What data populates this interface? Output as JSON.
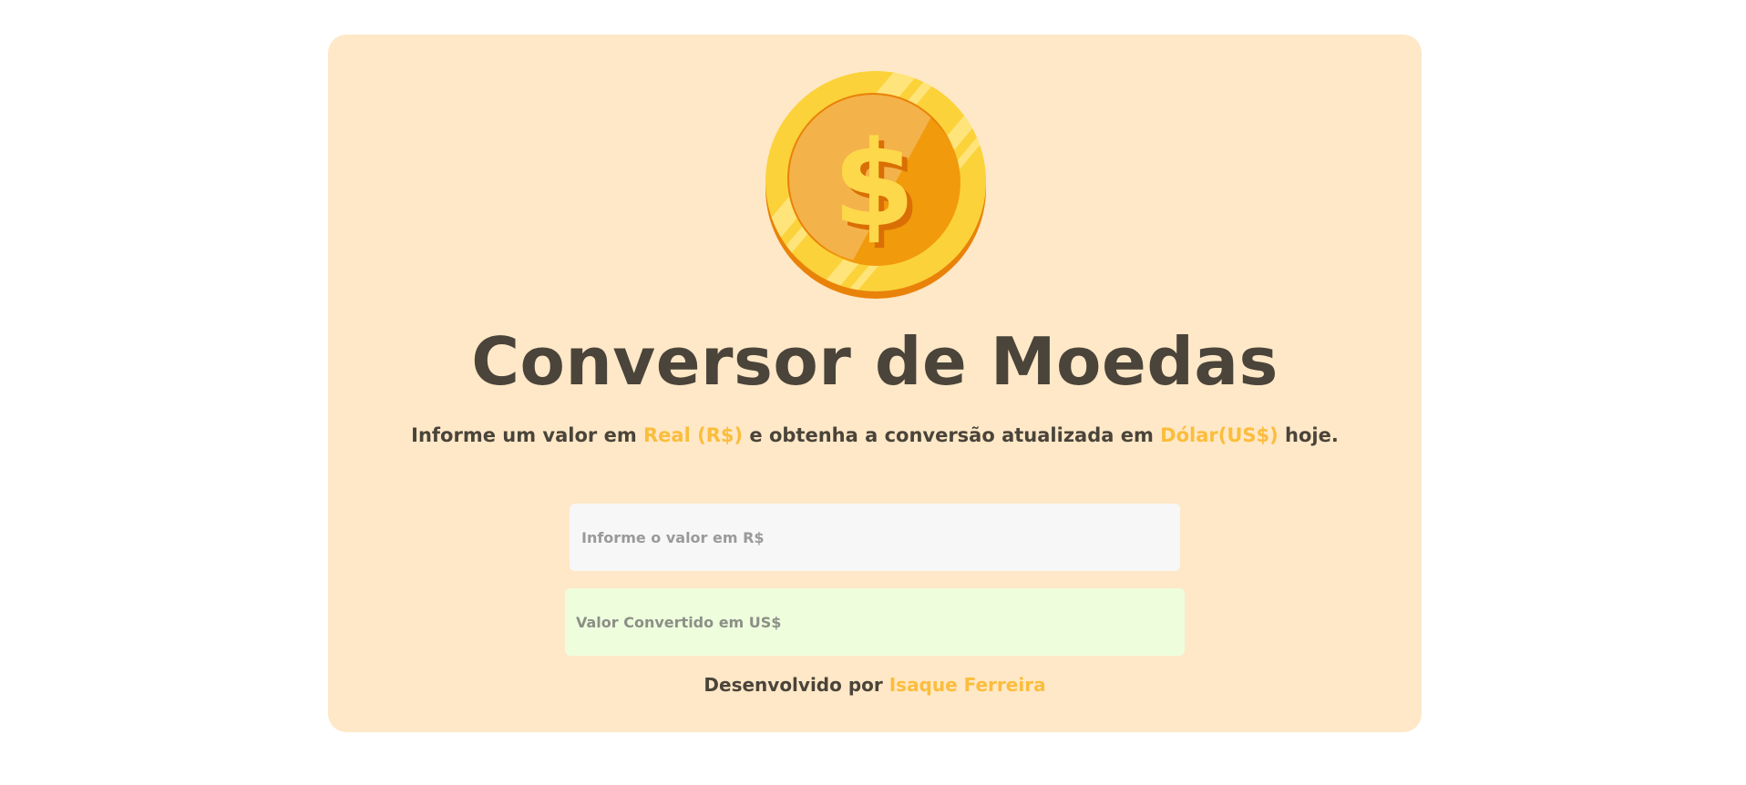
{
  "header": {
    "logo_icon": "dollar-coin-icon",
    "title": "Conversor de Moedas"
  },
  "subtitle": {
    "part1": "Informe um valor em ",
    "highlight1": "Real (R$)",
    "part2": " e obtenha a conversão atualizada em ",
    "highlight2": "Dólar(US$)",
    "part3": " hoje."
  },
  "form": {
    "real_input": {
      "value": "",
      "placeholder": "Informe o valor em R$"
    },
    "dolar_output": {
      "value": "",
      "placeholder": "Valor Convertido em US$"
    }
  },
  "footer": {
    "prefix": "Desenvolvido por ",
    "author": "Isaque Ferreira"
  },
  "colors": {
    "card_background": "#ffe8c7",
    "accent": "#fbbd3c",
    "text": "#4a443a",
    "input_background": "#f7f7f7",
    "output_background": "#eefedd"
  }
}
